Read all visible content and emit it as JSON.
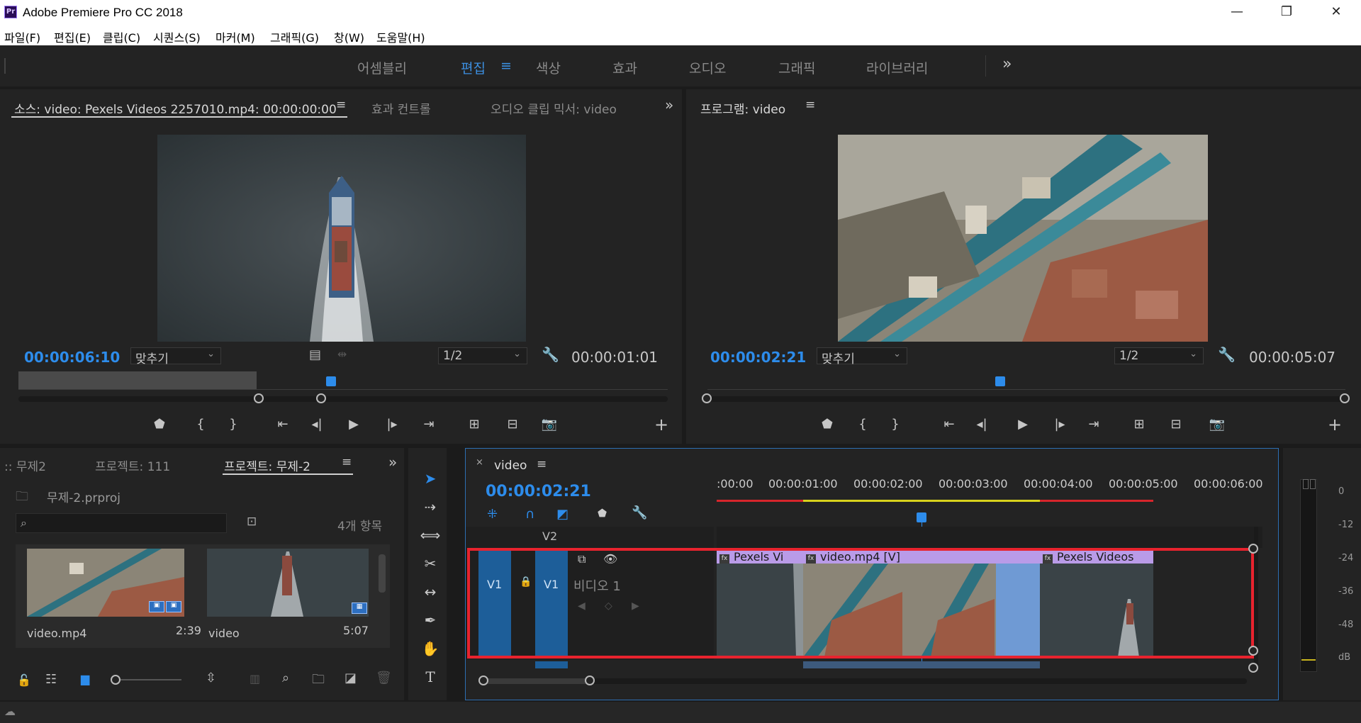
{
  "app": {
    "title": "Adobe Premiere Pro CC 2018",
    "logo_text": "Pr"
  },
  "menu": [
    "파일(F)",
    "편집(E)",
    "클립(C)",
    "시퀀스(S)",
    "마커(M)",
    "그래픽(G)",
    "창(W)",
    "도움말(H)"
  ],
  "workspaces": {
    "items": [
      "어셈블리",
      "편집",
      "색상",
      "효과",
      "오디오",
      "그래픽",
      "라이브러리"
    ],
    "active": "편집",
    "more": "»"
  },
  "source": {
    "tabs": [
      "소스: video: Pexels Videos 2257010.mp4: 00:00:00:00",
      "효과 컨트롤",
      "오디오 클립 믹서: video"
    ],
    "timecode": "00:00:06:10",
    "fit": "맞추기",
    "resolution": "1/2",
    "duration": "00:00:01:01"
  },
  "program": {
    "tab": "프로그램: video",
    "timecode": "00:00:02:21",
    "fit": "맞추기",
    "resolution": "1/2",
    "duration": "00:00:05:07"
  },
  "project": {
    "tabs": [
      ":: 무제2",
      "프로젝트: 111",
      "프로젝트: 무제-2"
    ],
    "file": "무제-2.prproj",
    "count": "4개 항목",
    "items": [
      {
        "name": "video.mp4",
        "duration": "2:39"
      },
      {
        "name": "video",
        "duration": "5:07"
      }
    ]
  },
  "timeline": {
    "tab": "video",
    "timecode": "00:00:02:21",
    "ruler": [
      ":00:00",
      "00:00:01:00",
      "00:00:02:00",
      "00:00:03:00",
      "00:00:04:00",
      "00:00:05:00",
      "00:00:06:00"
    ],
    "tracks": {
      "v2": "V2",
      "v1_src": "V1",
      "v1": "V1",
      "v1_name": "비디오 1"
    },
    "clips": [
      {
        "label": "Pexels Vi",
        "fx": "fx"
      },
      {
        "label": "video.mp4 [V]",
        "fx": "fx"
      },
      {
        "label": "Pexels Videos",
        "fx": "fx"
      }
    ]
  },
  "meter": {
    "labels": [
      "0",
      "-12",
      "-24",
      "-36",
      "-48",
      "dB"
    ]
  },
  "colors": {
    "accent": "#2d8ceb",
    "highlight_box": "#e8232e",
    "clip_label": "#b99be8"
  }
}
